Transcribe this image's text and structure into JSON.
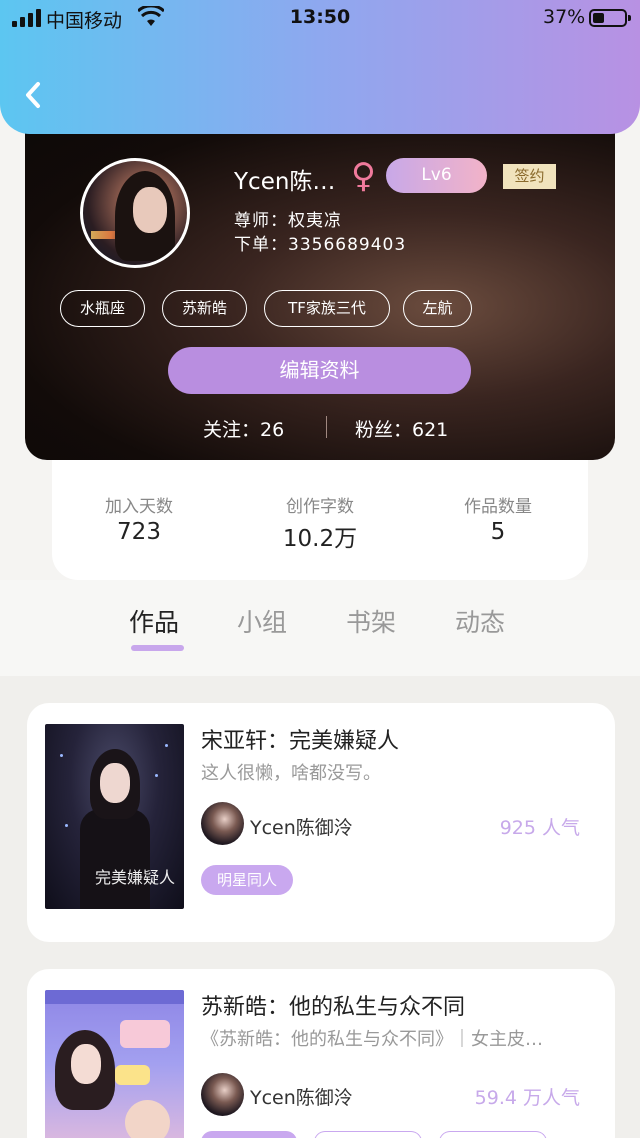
{
  "status_bar": {
    "carrier": "中国移动",
    "time": "13:50",
    "battery": "37%"
  },
  "header": {
    "back_icon": "chevron-left-icon"
  },
  "profile": {
    "username": "Ycen陈…",
    "gender_symbol": "♀",
    "level": "Lv6",
    "signed_label": "签约",
    "mentor_line": "尊师：权夷凉",
    "order_line": "下单：3356689403",
    "tags": [
      "水瓶座",
      "苏新皓",
      "TF家族三代",
      "左航"
    ],
    "edit_button": "编辑资料",
    "following": "关注：26",
    "followers": "粉丝：621"
  },
  "stats": [
    {
      "label": "加入天数",
      "value": "723"
    },
    {
      "label": "创作字数",
      "value": "10.2万"
    },
    {
      "label": "作品数量",
      "value": "5"
    }
  ],
  "tabs": [
    {
      "label": "作品",
      "active": true
    },
    {
      "label": "小组",
      "active": false
    },
    {
      "label": "书架",
      "active": false
    },
    {
      "label": "动态",
      "active": false
    }
  ],
  "works": [
    {
      "title": "宋亚轩：完美嫌疑人",
      "description": "这人很懒，啥都没写。",
      "author": "Ycen陈御泠",
      "popularity": "925 人气",
      "tag": "明星同人",
      "cover_text": "完美嫌疑人"
    },
    {
      "title": "苏新皓：他的私生与众不同",
      "description": "《苏新皓：他的私生与众不同》｜女主皮…",
      "author": "Ycen陈御泠",
      "popularity": "59.4 万人气"
    }
  ],
  "colors": {
    "accent": "#b98ee0",
    "popularity": "#c7a9ea",
    "gradient_start": "#5cc6f1",
    "gradient_end": "#b891e3"
  }
}
